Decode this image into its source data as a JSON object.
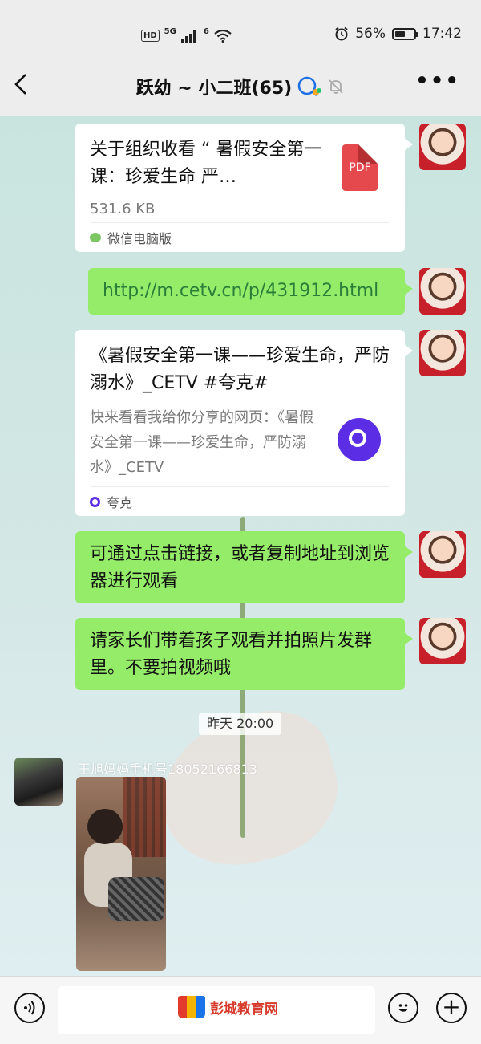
{
  "status_bar": {
    "network": "HD",
    "signal_label": "5G",
    "wifi_label": "6",
    "battery_percent": "56%",
    "battery_level": 0.56,
    "time": "17:42"
  },
  "header": {
    "title": "跃幼 ~ 小二班(65)",
    "icons": [
      "back-arrow-icon",
      "group-chat-icon",
      "mute-bell-icon",
      "more-icon"
    ]
  },
  "messages": {
    "file_card": {
      "title": "关于组织收看 “ 暑假安全第一课：珍爱生命  严…",
      "size": "531.6 KB",
      "source": "微信电脑版",
      "file_type": "PDF"
    },
    "link_text": "http://m.cetv.cn/p/431912.html",
    "share_card": {
      "title": "《暑假安全第一课——珍爱生命，严防溺水》_CETV   #夸克#",
      "desc": "快来看看我给你分享的网页：《暑假安全第一课——珍爱生命，严防溺水》_CETV",
      "source": "夸克"
    },
    "text_1": "可通过点击链接，或者复制地址到浏览器进行观看",
    "text_2": "请家长们带着孩子观看并拍照片发群里。不要拍视频哦",
    "timestamp": "昨天 20:00",
    "sender_name": "王旭妈妈手机号18052166813"
  },
  "input_bar": {
    "watermark": "彭城教育网",
    "plus_glyph": "+"
  },
  "colors": {
    "bubble_green": "#95ec69",
    "pdf_red": "#e5484d",
    "quark_purple": "#5b2ee6"
  }
}
